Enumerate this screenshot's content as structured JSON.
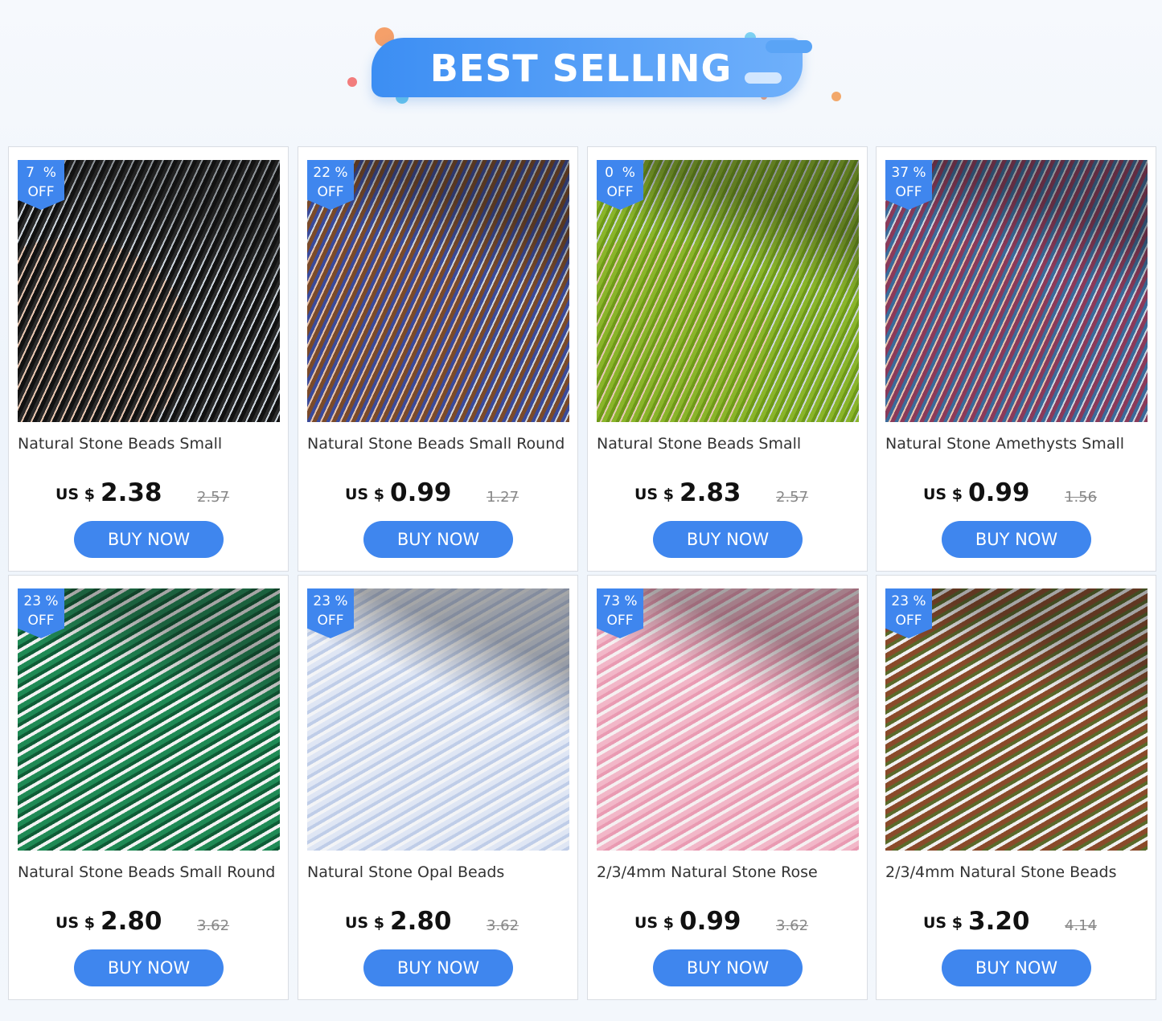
{
  "banner": {
    "title": "BEST SELLING"
  },
  "products": [
    {
      "discount": "7  %",
      "off": "OFF",
      "title": "Natural Stone Beads Small",
      "currency": "US $",
      "price": "2.38",
      "old_price": "2.57",
      "button": "BUY NOW",
      "image": "black-spinel-bead-strands-on-hand"
    },
    {
      "discount": "22 %",
      "off": "OFF",
      "title": "Natural Stone Beads Small Round",
      "currency": "US $",
      "price": "0.99",
      "old_price": "1.27",
      "button": "BUY NOW",
      "image": "multicolor-metallic-bead-strands-on-hand"
    },
    {
      "discount": "0  %",
      "off": "OFF",
      "title": "Natural Stone Beads Small",
      "currency": "US $",
      "price": "2.83",
      "old_price": "2.57",
      "button": "BUY NOW",
      "image": "green-peridot-bead-strands-on-hand"
    },
    {
      "discount": "37 %",
      "off": "OFF",
      "title": "Natural Stone Amethysts Small",
      "currency": "US $",
      "price": "0.99",
      "old_price": "1.56",
      "button": "BUY NOW",
      "image": "mixed-gemstone-bead-strands-on-hand"
    },
    {
      "discount": "23 %",
      "off": "OFF",
      "title": "Natural Stone Beads Small Round",
      "currency": "US $",
      "price": "2.80",
      "old_price": "3.62",
      "button": "BUY NOW",
      "image": "green-agate-bead-strands"
    },
    {
      "discount": "23 %",
      "off": "OFF",
      "title": "Natural Stone Opal Beads",
      "currency": "US $",
      "price": "2.80",
      "old_price": "3.62",
      "button": "BUY NOW",
      "image": "opal-bead-strands"
    },
    {
      "discount": "73 %",
      "off": "OFF",
      "title": "2/3/4mm Natural Stone Rose",
      "currency": "US $",
      "price": "0.99",
      "old_price": "3.62",
      "button": "BUY NOW",
      "image": "rose-quartz-bead-strands"
    },
    {
      "discount": "23 %",
      "off": "OFF",
      "title": "2/3/4mm Natural Stone Beads",
      "currency": "US $",
      "price": "3.20",
      "old_price": "4.14",
      "button": "BUY NOW",
      "image": "mixed-zircon-bead-strands"
    }
  ],
  "colors": {
    "accent": "#3f86ee",
    "banner_start": "#3c8ef3",
    "banner_end": "#6fb0fb"
  }
}
